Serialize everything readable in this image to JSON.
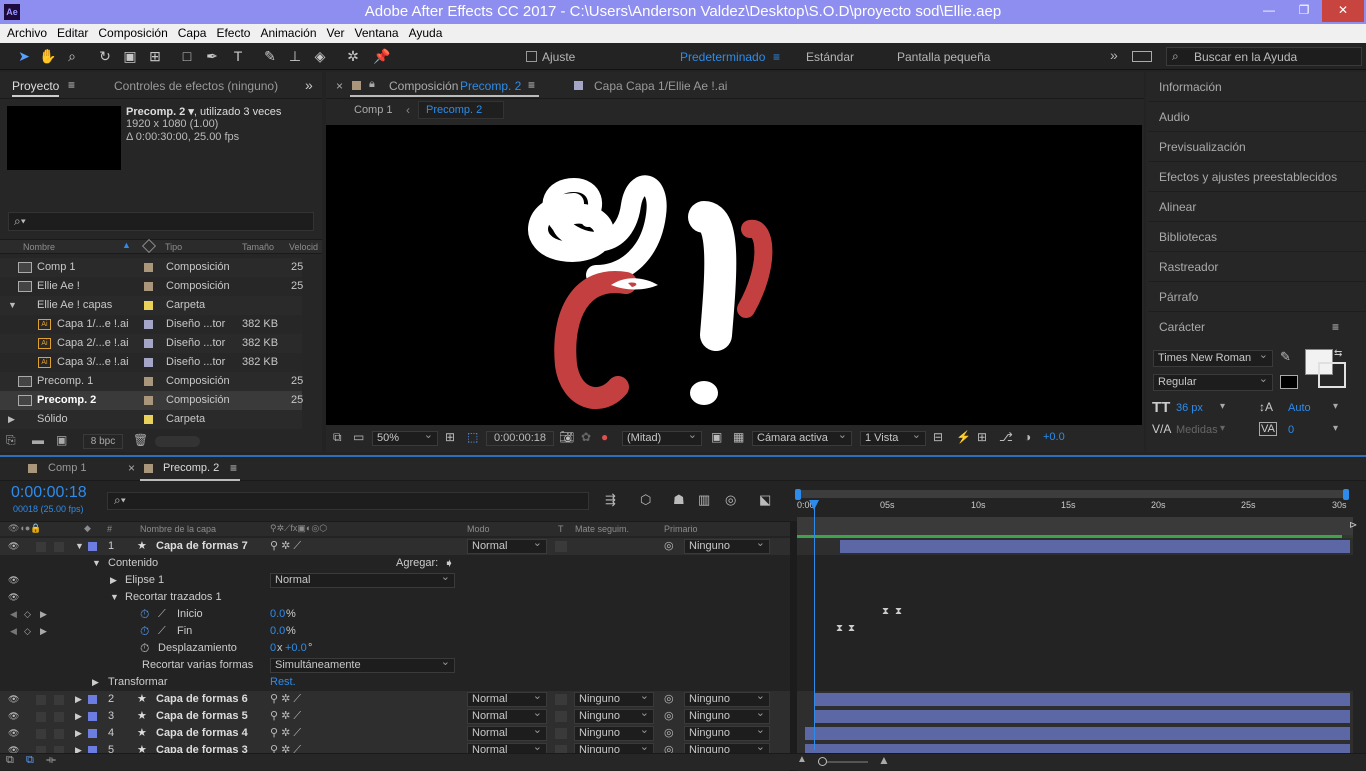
{
  "window": {
    "app_icon": "Ae",
    "title": "Adobe After Effects CC 2017 - C:\\Users\\Anderson Valdez\\Desktop\\S.O.D\\proyecto sod\\Ellie.aep",
    "minimize": "—",
    "restore": "❐",
    "close": "✕"
  },
  "menu": [
    "Archivo",
    "Editar",
    "Composición",
    "Capa",
    "Efecto",
    "Animación",
    "Ver",
    "Ventana",
    "Ayuda"
  ],
  "toolbar": {
    "ajuste": "Ajuste",
    "workspaces": [
      "Predeterminado",
      "Estándar",
      "Pantalla pequeña"
    ],
    "more": "»",
    "search_placeholder": "Buscar en la Ayuda"
  },
  "project": {
    "tab_project": "Proyecto",
    "tab_effects": "Controles de efectos (ninguno)",
    "more": "»",
    "selected_name": "Precomp. 2 ▾",
    "used": ", utilizado 3 veces",
    "resolution": "1920 x 1080 (1.00)",
    "duration": "Δ 0:00:30:00, 25.00 fps",
    "search_icon": "⌕▾",
    "columns": {
      "name": "Nombre",
      "type": "Tipo",
      "size": "Tamaño",
      "speed": "Velocid"
    },
    "items": [
      {
        "name": "Comp 1",
        "type": "Composición",
        "size": "",
        "speed": "25",
        "color": "#a9967b",
        "indent": 0,
        "icon": "comp"
      },
      {
        "name": "Ellie Ae !",
        "type": "Composición",
        "size": "",
        "speed": "25",
        "color": "#a9967b",
        "indent": 0,
        "icon": "comp"
      },
      {
        "name": "Ellie Ae ! capas",
        "type": "Carpeta",
        "size": "",
        "speed": "",
        "color": "#e8d25a",
        "indent": 0,
        "icon": "folder"
      },
      {
        "name": "Capa 1/...e !.ai",
        "type": "Diseño ...tor",
        "size": "382 KB",
        "speed": "",
        "color": "#a5a5c8",
        "indent": 1,
        "icon": "ai"
      },
      {
        "name": "Capa 2/...e !.ai",
        "type": "Diseño ...tor",
        "size": "382 KB",
        "speed": "",
        "color": "#a5a5c8",
        "indent": 1,
        "icon": "ai"
      },
      {
        "name": "Capa 3/...e !.ai",
        "type": "Diseño ...tor",
        "size": "382 KB",
        "speed": "",
        "color": "#a5a5c8",
        "indent": 1,
        "icon": "ai"
      },
      {
        "name": "Precomp. 1",
        "type": "Composición",
        "size": "",
        "speed": "25",
        "color": "#a9967b",
        "indent": 0,
        "icon": "comp"
      },
      {
        "name": "Precomp. 2",
        "type": "Composición",
        "size": "",
        "speed": "25",
        "color": "#a9967b",
        "indent": 0,
        "icon": "comp",
        "selected": true
      },
      {
        "name": "Sólido",
        "type": "Carpeta",
        "size": "",
        "speed": "",
        "color": "#e8d25a",
        "indent": 0,
        "icon": "folder"
      }
    ],
    "bpc": "8 bpc"
  },
  "comp": {
    "tab_close": "×",
    "tab_lock": "🔒",
    "tab_label": "Composición",
    "tab_name": "Precomp. 2",
    "tab_menu": "≡",
    "layer_tab": "Capa  Capa 1/Ellie Ae !.ai",
    "breadcrumb": [
      "Comp 1",
      "Precomp. 2"
    ],
    "zoom": "50%",
    "timecode": "0:00:00:18",
    "resolution": "(Mitad)",
    "camera": "Cámara activa",
    "views": "1 Vista",
    "exposure": "+0.0"
  },
  "right_panel": {
    "items": [
      "Información",
      "Audio",
      "Previsualización",
      "Efectos y ajustes preestablecidos",
      "Alinear",
      "Bibliotecas",
      "Rastreador",
      "Párrafo"
    ],
    "character": {
      "title": "Carácter",
      "menu": "≡",
      "font": "Times New Roman",
      "style": "Regular",
      "size": "36 px",
      "leading": "Auto",
      "kerning": "Medidas",
      "tracking": "0",
      "fill": "#f2f2f2"
    }
  },
  "timeline": {
    "tabs": [
      {
        "name": "Comp 1"
      },
      {
        "name": "Precomp. 2",
        "active": true
      }
    ],
    "timecode": "0:00:00:18",
    "fps": "00018 (25.00 fps)",
    "ruler": [
      "0:00",
      "05s",
      "10s",
      "15s",
      "20s",
      "25s",
      "30s"
    ],
    "columns": {
      "num": "#",
      "layer": "Nombre de la capa",
      "mode": "Modo",
      "t": "T",
      "matte": "Mate seguim.",
      "parent": "Primario"
    },
    "layer1": {
      "num": "1",
      "name": "Capa de formas 7",
      "mode": "Normal",
      "parent": "Ninguno"
    },
    "contents": "Contenido",
    "add": "Agregar:",
    "ellipse": "Elipse 1",
    "ellipse_mode": "Normal",
    "trim": "Recortar trazados 1",
    "start": {
      "label": "Inicio",
      "value": "0.0",
      "unit": "%"
    },
    "end": {
      "label": "Fin",
      "value": "0.0",
      "unit": "%"
    },
    "offset": {
      "label": "Desplazamiento",
      "value_x": "0",
      "x": "x",
      "value": "+0.0",
      "unit": "°"
    },
    "trim_multi": {
      "label": "Recortar varias formas",
      "value": "Simultáneamente"
    },
    "transform": {
      "label": "Transformar",
      "reset": "Rest."
    },
    "layers": [
      {
        "num": "2",
        "name": "Capa de formas 6",
        "mode": "Normal",
        "matte": "Ninguno",
        "parent": "Ninguno"
      },
      {
        "num": "3",
        "name": "Capa de formas 5",
        "mode": "Normal",
        "matte": "Ninguno",
        "parent": "Ninguno"
      },
      {
        "num": "4",
        "name": "Capa de formas 4",
        "mode": "Normal",
        "matte": "Ninguno",
        "parent": "Ninguno"
      },
      {
        "num": "5",
        "name": "Capa de formas 3",
        "mode": "Normal",
        "matte": "Ninguno",
        "parent": "Ninguno"
      }
    ],
    "playhead_fraction": 0.024
  }
}
